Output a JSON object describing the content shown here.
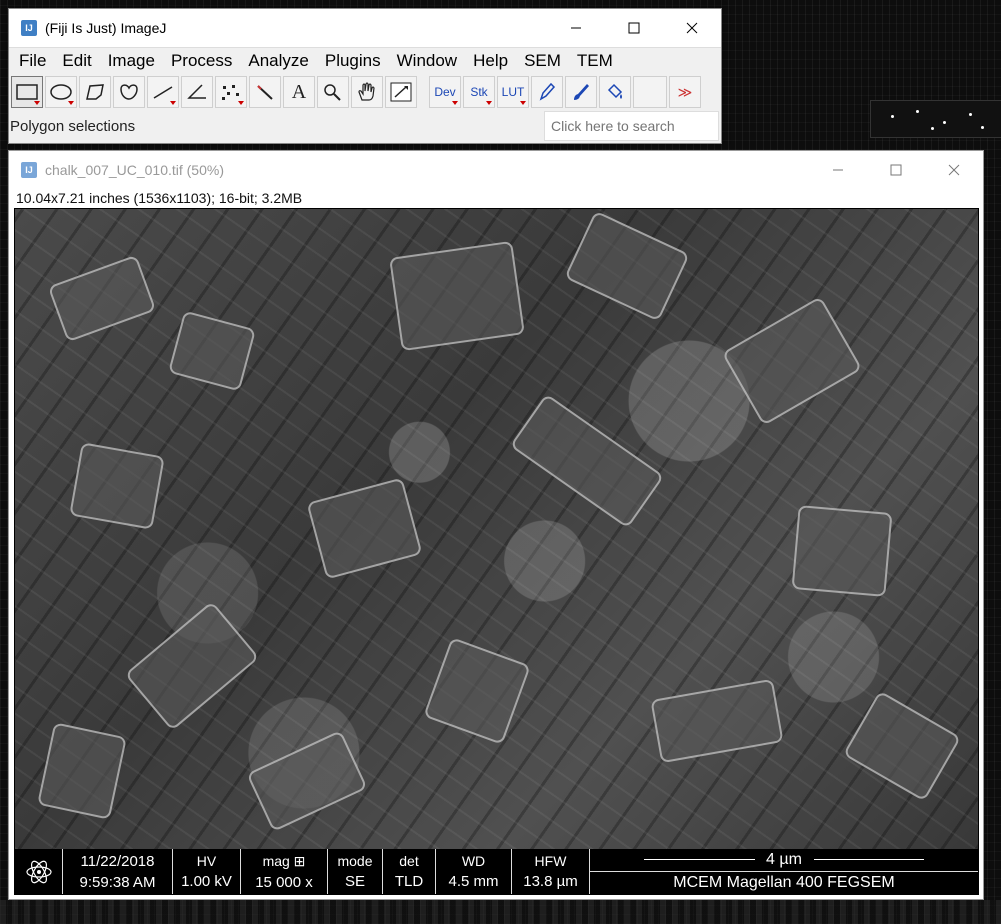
{
  "main_window": {
    "title": "(Fiji Is Just) ImageJ",
    "icon_text": "IJ",
    "menu": [
      "File",
      "Edit",
      "Image",
      "Process",
      "Analyze",
      "Plugins",
      "Window",
      "Help",
      "SEM",
      "TEM"
    ],
    "tools": [
      {
        "name": "rectangle-tool",
        "glyph": "▭"
      },
      {
        "name": "oval-tool",
        "glyph": "◯"
      },
      {
        "name": "polygon-tool",
        "glyph": "⬠"
      },
      {
        "name": "freehand-tool",
        "glyph": "♡"
      },
      {
        "name": "line-tool",
        "glyph": "╱"
      },
      {
        "name": "angle-tool",
        "glyph": "∠"
      },
      {
        "name": "multipoint-tool",
        "glyph": "⁙"
      },
      {
        "name": "wand-tool",
        "glyph": "⟋"
      },
      {
        "name": "text-tool",
        "glyph": "A"
      },
      {
        "name": "magnifier-tool",
        "glyph": "🔍"
      },
      {
        "name": "scroll-tool",
        "glyph": "✋"
      },
      {
        "name": "color-picker-tool",
        "glyph": "⤢"
      }
    ],
    "extra_tools": [
      {
        "name": "dev-tool",
        "label": "Dev"
      },
      {
        "name": "stk-tool",
        "label": "Stk"
      },
      {
        "name": "lut-tool",
        "label": "LUT"
      },
      {
        "name": "pencil-tool",
        "label": "✎"
      },
      {
        "name": "brush-tool",
        "label": "🖌"
      },
      {
        "name": "flood-fill-tool",
        "label": "🪣"
      },
      {
        "name": "empty-tool",
        "label": ""
      },
      {
        "name": "more-tools",
        "label": "≫"
      }
    ],
    "status": "Polygon selections",
    "search_placeholder": "Click here to search"
  },
  "image_window": {
    "title": "chalk_007_UC_010.tif (50%)",
    "info": "10.04x7.21 inches (1536x1103); 16-bit; 3.2MB",
    "databar": {
      "date": "11/22/2018",
      "time": "9:59:38 AM",
      "hv_label": "HV",
      "hv_value": "1.00 kV",
      "mag_label": "mag ⊞",
      "mag_value": "15 000 x",
      "mode_label": "mode",
      "mode_value": "SE",
      "det_label": "det",
      "det_value": "TLD",
      "wd_label": "WD",
      "wd_value": "4.5 mm",
      "hfw_label": "HFW",
      "hfw_value": "13.8 µm",
      "scale_label": "4 µm",
      "instrument": "MCEM Magellan 400 FEGSEM"
    }
  }
}
